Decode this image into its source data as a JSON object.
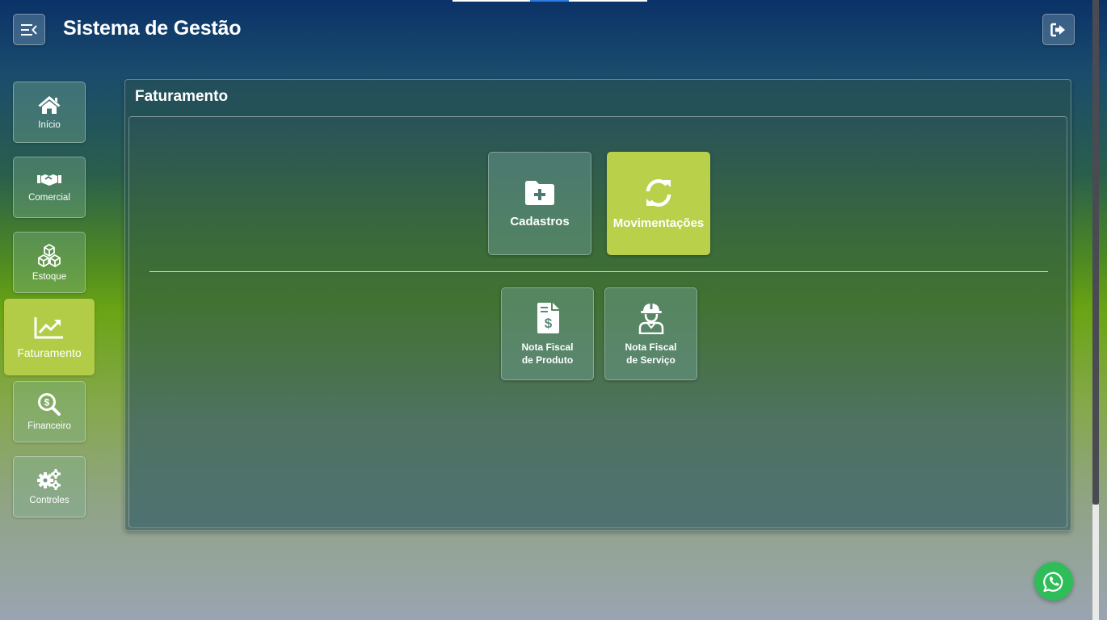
{
  "app": {
    "title": "Sistema de Gestão"
  },
  "header": {
    "menu_icon": "menu-collapse-icon",
    "logout_icon": "logout-icon"
  },
  "sidebar": {
    "items": [
      {
        "label": "Início",
        "icon": "home-icon"
      },
      {
        "label": "Comercial",
        "icon": "handshake-icon"
      },
      {
        "label": "Estoque",
        "icon": "boxes-icon"
      },
      {
        "label": "Faturamento",
        "icon": "chart-line-icon",
        "active": true
      },
      {
        "label": "Financeiro",
        "icon": "search-dollar-icon"
      },
      {
        "label": "Controles",
        "icon": "cogs-icon"
      }
    ]
  },
  "main": {
    "title": "Faturamento",
    "tabs": [
      {
        "label": "Cadastros",
        "icon": "folder-plus-icon"
      },
      {
        "label": "Movimentações",
        "icon": "sync-icon",
        "active": true
      }
    ],
    "tiles": [
      {
        "line1": "Nota Fiscal",
        "line2": "de Produto",
        "icon": "invoice-dollar-icon"
      },
      {
        "line1": "Nota Fiscal",
        "line2": "de Serviço",
        "icon": "hard-hat-worker-icon"
      }
    ]
  },
  "colors": {
    "accent": "#b3cc47",
    "whatsapp": "#2fbd59"
  },
  "whatsapp": {
    "icon": "whatsapp-icon"
  }
}
